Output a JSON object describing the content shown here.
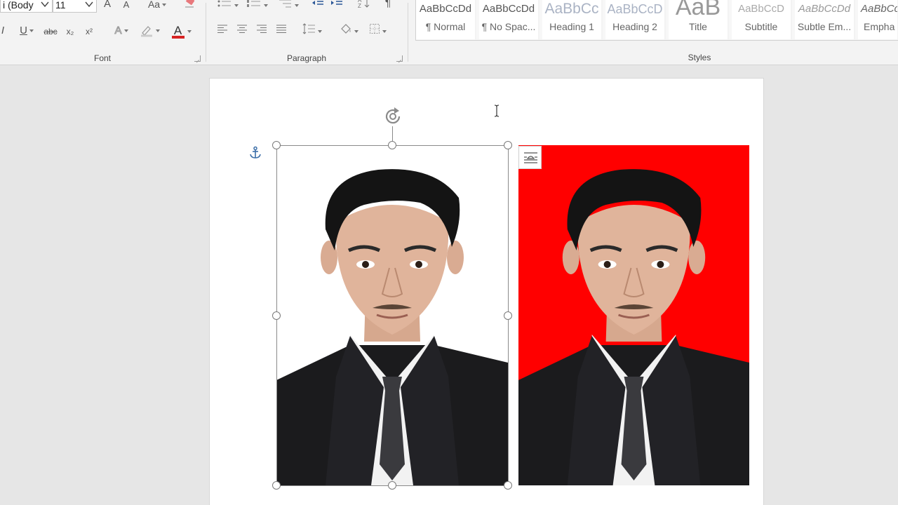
{
  "ribbon": {
    "font": {
      "label": "Font",
      "font_name": "i (Body",
      "font_size": "11",
      "grow_glyph": "A",
      "shrink_glyph": "A",
      "case_glyph": "Aa",
      "underline_glyph": "U",
      "strike_glyph": "abc",
      "subscript_glyph": "x₂",
      "superscript_glyph": "x²",
      "effects_glyph": "A",
      "color_glyph": "A",
      "font_color": "#d62323"
    },
    "paragraph": {
      "label": "Paragraph"
    },
    "styles": {
      "label": "Styles",
      "items": [
        {
          "preview": "AaBbCcDd",
          "name": "¶ Normal"
        },
        {
          "preview": "AaBbCcDd",
          "name": "¶ No Spac..."
        },
        {
          "preview": "AaBbCc",
          "name": "Heading 1"
        },
        {
          "preview": "AaBbCcD",
          "name": "Heading 2"
        },
        {
          "preview": "AaB",
          "name": "Title"
        },
        {
          "preview": "AaBbCcD",
          "name": "Subtitle"
        },
        {
          "preview": "AaBbCcDd",
          "name": "Subtle Em..."
        },
        {
          "preview": "AaBbCc",
          "name": "Empha"
        }
      ]
    }
  },
  "document": {
    "photos": [
      {
        "name": "photo-white-background",
        "background_color": "#ffffff",
        "selected": true
      },
      {
        "name": "photo-red-background",
        "background_color": "#ff0000",
        "selected": false
      }
    ]
  },
  "icons": {
    "anchor": "anchor-icon",
    "rotate": "rotate-handle-icon",
    "layout_options": "layout-options-icon",
    "text_cursor": "text-cursor-icon"
  }
}
